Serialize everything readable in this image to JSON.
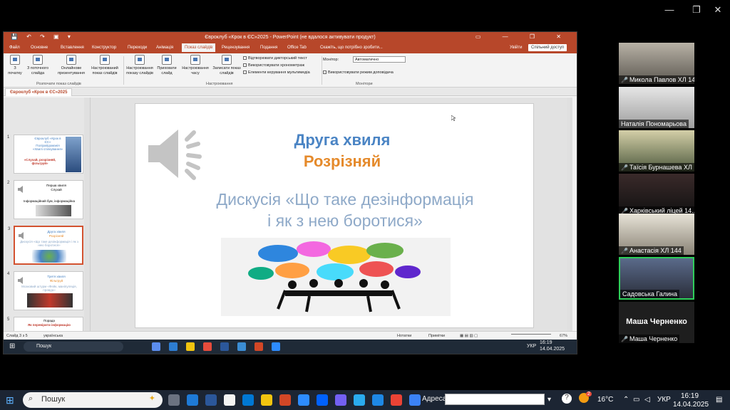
{
  "outer_window": {
    "minimize": "—",
    "restore": "❐",
    "close": "✕"
  },
  "ppt": {
    "title": "Євроклуб «Крок в ЄС»2025 - PowerPoint (не вдалося активувати продукт)",
    "tabs": [
      "Файл",
      "Основне",
      "Вставлення",
      "Конструктор",
      "Переходи",
      "Анімація",
      "Показ слайдів",
      "Рецензування",
      "Подання",
      "Office Tab"
    ],
    "tell_me": "Скажіть, що потрібно зробити...",
    "sign_in": "Увійти",
    "share": "Спільний доступ",
    "ribbon": {
      "from_start": "З початку",
      "from_current": "З поточного слайда",
      "online": "Онлайнове презентування",
      "custom": "Настроюваний показ слайдів",
      "group1": "Розпочати показ слайдів",
      "setup": "Настроювання показу слайдів",
      "hide": "Приховати слайд",
      "rehearse": "Настроювання часу",
      "record": "Записати показ слайдів",
      "chk_narration": "Відтворювати дикторський текст",
      "chk_timings": "Використовувати хронометраж",
      "chk_media": "Елементи керування мультимедіа",
      "group2": "Настроювання",
      "monitor_label": "Монітор:",
      "monitor_value": "Автоматично",
      "chk_presenter": "Використовувати режим доповідача",
      "group3": "Монітори"
    },
    "doc_tab": "Євроклуб «Крок в ЄС»2025",
    "thumbs": [
      {
        "num": "1",
        "lines": [
          "Євроклуб «Крок в ЄС»",
          "Полірайдоманія «Хвилі спілкування»",
          "«Слухай, розрізняй, фільтруй»"
        ]
      },
      {
        "num": "2",
        "lines": [
          "Перша хвиля",
          "Слухай",
          "Інформаційний бум, інформаційна"
        ]
      },
      {
        "num": "3",
        "lines": [
          "Друга хвиля",
          "Розрізняй",
          "Дискусія «Що таке дезінформація і як з нею боротися»"
        ]
      },
      {
        "num": "4",
        "lines": [
          "Третя хвиля",
          "Фільтруй",
          "Мозковий штурм «Фейк, маніпуляція, правда»"
        ]
      },
      {
        "num": "5",
        "lines": [
          "Порада",
          "Як перевірити інформацію"
        ]
      }
    ],
    "slide": {
      "title1": "Друга хвиля",
      "title2": "Розрізняй",
      "line1": "Дискусія «Що таке дезінформація",
      "line2": "і як з нею боротися»"
    },
    "status": {
      "slide": "Слайд 3 з 5",
      "lang": "українська",
      "notes": "Нотатки",
      "comments": "Примітки",
      "zoom": "67%"
    },
    "taskbar": {
      "search": "Пошук",
      "lang": "УКР",
      "time": "16:19",
      "date": "14.04.2025"
    }
  },
  "participants": [
    {
      "name": "Микола Павлов ХЛ 144",
      "muted": true
    },
    {
      "name": "Наталія Пономарьова",
      "muted": false
    },
    {
      "name": "Таїсія Бурнашева ХЛ ...",
      "muted": true
    },
    {
      "name": "Харківський ліцей 14...",
      "muted": true
    },
    {
      "name": "Анастасія ХЛ 144",
      "muted": true
    },
    {
      "name": "Садовська Галина",
      "muted": false
    },
    {
      "name": "Маша Черненко",
      "muted": true,
      "big": "Маша Черненко"
    }
  ],
  "taskbar": {
    "search": "Пошук",
    "address_label": "Адреса",
    "weather": "16°C",
    "lang": "УКР",
    "time": "16:19",
    "date": "14.04.2025",
    "badge": "2"
  },
  "colors": {
    "ppt_accent": "#b7472a",
    "slide_blue": "#4a84c4",
    "slide_orange": "#e58a2b",
    "active_tile": "#2fcf5a"
  }
}
